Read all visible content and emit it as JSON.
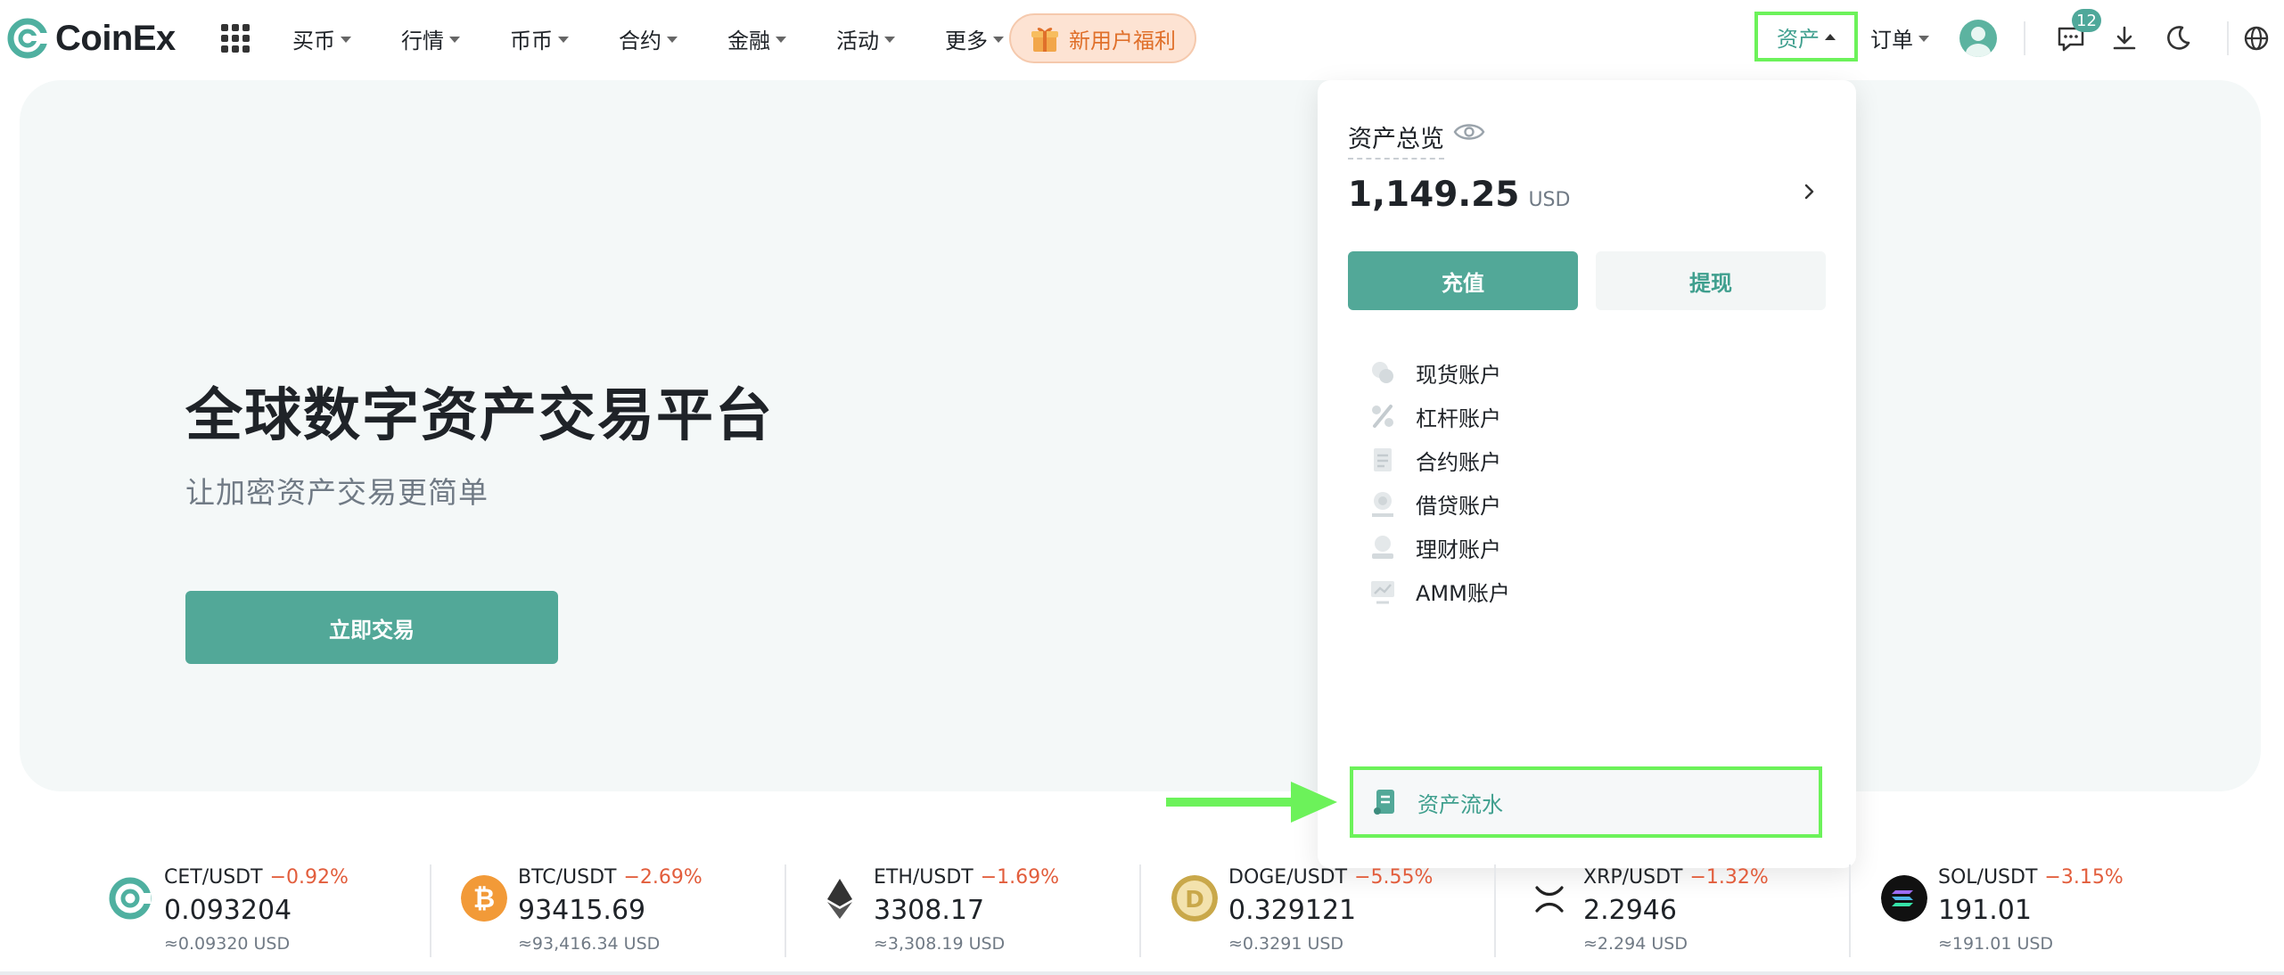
{
  "header": {
    "logo_text": "CoinEx",
    "nav": [
      {
        "label": "买币"
      },
      {
        "label": "行情"
      },
      {
        "label": "币币"
      },
      {
        "label": "合约"
      },
      {
        "label": "金融"
      },
      {
        "label": "活动"
      },
      {
        "label": "更多"
      }
    ],
    "promo_label": "新用户福利",
    "assets_label": "资产",
    "orders_label": "订单",
    "notification_count": "12"
  },
  "hero": {
    "title": "全球数字资产交易平台",
    "subtitle": "让加密资产交易更简单",
    "cta_label": "立即交易"
  },
  "assets_dropdown": {
    "overview_label": "资产总览",
    "total_amount": "1,149.25",
    "total_unit": "USD",
    "deposit_label": "充值",
    "withdraw_label": "提现",
    "items": [
      {
        "label": "现货账户",
        "icon": "spot-account-icon"
      },
      {
        "label": "杠杆账户",
        "icon": "margin-account-icon"
      },
      {
        "label": "合约账户",
        "icon": "futures-account-icon"
      },
      {
        "label": "借贷账户",
        "icon": "loan-account-icon"
      },
      {
        "label": "理财账户",
        "icon": "financial-account-icon"
      },
      {
        "label": "AMM账户",
        "icon": "amm-account-icon"
      }
    ],
    "history_label": "资产流水"
  },
  "ticker": [
    {
      "pair": "CET/USDT",
      "change": "−0.92%",
      "price": "0.093204",
      "usd": "≈0.09320 USD",
      "icon": "cet-icon"
    },
    {
      "pair": "BTC/USDT",
      "change": "−2.69%",
      "price": "93415.69",
      "usd": "≈93,416.34 USD",
      "icon": "btc-icon"
    },
    {
      "pair": "ETH/USDT",
      "change": "−1.69%",
      "price": "3308.17",
      "usd": "≈3,308.19 USD",
      "icon": "eth-icon"
    },
    {
      "pair": "DOGE/USDT",
      "change": "−5.55%",
      "price": "0.329121",
      "usd": "≈0.3291 USD",
      "icon": "doge-icon"
    },
    {
      "pair": "XRP/USDT",
      "change": "−1.32%",
      "price": "2.2946",
      "usd": "≈2.294 USD",
      "icon": "xrp-icon"
    },
    {
      "pair": "SOL/USDT",
      "change": "−3.15%",
      "price": "191.01",
      "usd": "≈191.01 USD",
      "icon": "sol-icon"
    }
  ],
  "colors": {
    "brand": "#52a898",
    "negative": "#e25d3c",
    "highlight": "#6cf25a"
  }
}
